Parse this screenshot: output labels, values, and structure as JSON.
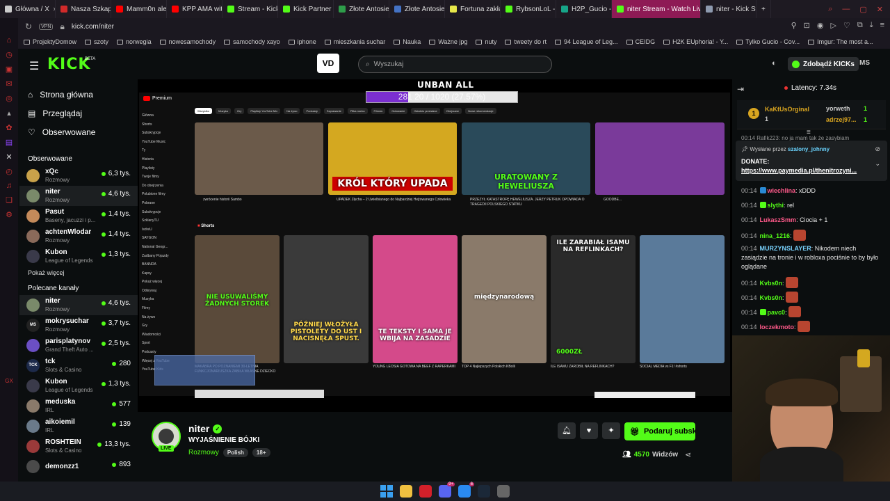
{
  "browser": {
    "tabs": [
      {
        "label": "Główna / X",
        "color": "#cccccc"
      },
      {
        "label": "Nasza Szkapa",
        "color": "#d12a2a"
      },
      {
        "label": "Mamm0n ale",
        "color": "#ff0000"
      },
      {
        "label": "KPP AMA with",
        "color": "#ff0000"
      },
      {
        "label": "Stream - Kick",
        "color": "#53fc18"
      },
      {
        "label": "Kick Partner P",
        "color": "#53fc18"
      },
      {
        "label": "Złote Antosie",
        "color": "#2e9d4a"
      },
      {
        "label": "Złote Antosie",
        "color": "#4472c4"
      },
      {
        "label": "Fortuna zakła",
        "color": "#e8e84a"
      },
      {
        "label": "RybsonLoL -",
        "color": "#53fc18"
      },
      {
        "label": "H2P_Gucio -",
        "color": "#17a589"
      },
      {
        "label": "niter Stream - Watch Live",
        "color": "#53fc18",
        "active": true
      },
      {
        "label": "niter - Kick St",
        "color": "#8e9aaf"
      }
    ],
    "vpn": "VPN",
    "url": "kick.com/niter",
    "bookmarks": [
      "ProjektyDomow",
      "szoty",
      "norwegia",
      "nowesamochody",
      "samochody xayo",
      "iphone",
      "mieszkania suchar",
      "Nauka",
      "Ważne jpg",
      "nuty",
      "tweety do rt",
      "94 League of Leg...",
      "CEIDG",
      "H2K EUphoria! - Y...",
      "Tylko Gucio - Cov...",
      "Imgur: The most a..."
    ]
  },
  "header": {
    "logo": "KICK",
    "beta": "BETA",
    "vd_logo": "VD",
    "search_placeholder": "Wyszukaj",
    "get_kicks": "Zdobądź KICKs",
    "user_initials": "MS"
  },
  "sidebar": {
    "nav": [
      {
        "label": "Strona główna",
        "icon": "home"
      },
      {
        "label": "Przeglądaj",
        "icon": "browse"
      },
      {
        "label": "Obserwowane",
        "icon": "heart"
      }
    ],
    "followed_title": "Obserwowane",
    "followed": [
      {
        "name": "xQc",
        "cat": "Rozmowy",
        "viewers": "6,3 tys.",
        "color": "#c9a24a"
      },
      {
        "name": "niter",
        "cat": "Rozmowy",
        "viewers": "4,6 tys.",
        "color": "#7a8a6a",
        "selected": true
      },
      {
        "name": "Pasut",
        "cat": "Baseny, jacuzzi i p...",
        "viewers": "1,4 tys.",
        "color": "#c48a5a"
      },
      {
        "name": "achtenWlodar",
        "cat": "Rozmowy",
        "viewers": "1,4 tys.",
        "color": "#8a6a5a"
      },
      {
        "name": "Kubon",
        "cat": "League of Legends",
        "viewers": "1,3 tys.",
        "color": "#3a3a4a"
      }
    ],
    "show_more": "Pokaż więcej",
    "recommended_title": "Polecane kanały",
    "recommended": [
      {
        "name": "niter",
        "cat": "Rozmowy",
        "viewers": "4,6 tys.",
        "color": "#7a8a6a",
        "selected": true
      },
      {
        "name": "mokrysuchar",
        "cat": "Rozmowy",
        "viewers": "3,7 tys.",
        "color": "#222222",
        "initials": "MS"
      },
      {
        "name": "parisplatynov",
        "cat": "Grand Theft Auto ...",
        "viewers": "2,5 tys.",
        "color": "#6b4fc4"
      },
      {
        "name": "tck",
        "cat": "Slots & Casino",
        "viewers": "280",
        "color": "#1d2a4a",
        "initials": "TCK"
      },
      {
        "name": "Kubon",
        "cat": "League of Legends",
        "viewers": "1,3 tys.",
        "color": "#3a3a4a"
      },
      {
        "name": "meduska",
        "cat": "IRL",
        "viewers": "577",
        "color": "#8a7a6a"
      },
      {
        "name": "aikoiemil",
        "cat": "IRL",
        "viewers": "139",
        "color": "#6a7a8a"
      },
      {
        "name": "ROSHTEIN",
        "cat": "Slots & Casino",
        "viewers": "13,3 tys.",
        "color": "#9a3a3a"
      },
      {
        "name": "demonzz1",
        "cat": "",
        "viewers": "893",
        "color": "#4a4a4a"
      }
    ]
  },
  "video": {
    "overlay_title": "UNBAN ALL",
    "progress_text": "281 20 / 1020 (27.57%)",
    "progress_fraction": 0.2757,
    "youtube": {
      "premium": "Premium",
      "side_items": [
        "Główna",
        "Shorts",
        "Subskrypcje",
        "YouTube Music",
        "Ty",
        "Historia",
        "Playlisty",
        "Twoje filmy",
        "Do obejrzenia",
        "Polubione filmy",
        "Pobrane",
        "Subskrypcje",
        "SzklanyTU",
        "IsdreU",
        "SAYGON",
        "National Geogr...",
        "Zadbany Pojazdy",
        "BANNDA",
        "Kapsy",
        "Pokaż więcej",
        "Odkrywaj",
        "Muzyka",
        "Filmy",
        "Na żywo",
        "Gry",
        "Wiadomości",
        "Sport",
        "Podcasty",
        "Więcej z YouTube",
        "YouTube Kids"
      ],
      "chips": [
        "Wszystko",
        "Muzyka",
        "Gry",
        "Playlisty YouTube Mix",
        "Na żywo",
        "Podcasty",
        "Szprawanie",
        "Piłka nożna",
        "Filmów",
        "Gotowanie",
        "Ostatnio przesłane",
        "Obejrzane",
        "Nowe rekomendacje"
      ],
      "videos": [
        {
          "overlay": "",
          "caption": "zwrócenie historii Sambo",
          "color": "#6b5a4a"
        },
        {
          "overlay": "KRÓL KTÓRY UPADA",
          "caption": "UPADEK Złycha – 2 Uwielbianego do Najbardziej Hejtowanego Człowieka",
          "color": "#d4a820"
        },
        {
          "overlay": "URATOWANY Z HEWELIUSZA",
          "caption": "PRZEŻYŁ KATASTROFĘ HEWELIUSZA. JERZY PETRUK OPOWIADA O TRAGEDII POLSKIEGO STATKU",
          "color": "#2a4a5a"
        },
        {
          "overlay": "",
          "caption": "GOODBE...",
          "color": "#7a3a9a"
        }
      ],
      "shorts_label": "Shorts",
      "shorts": [
        {
          "overlay": "NIE USUWALIŚMY ŻADNYCH STOREK",
          "caption": "MAKABRA PO POZNANIEMI 30-LETNIA FUNKCJONARIUSZKA ZABIŁA WŁASNE DZIECKO I...",
          "color": "#5a4a3a"
        },
        {
          "overlay": "PÓŹNIEJ WŁOŻYŁA PISTOLETY DO UST I NACISNĘŁA SPUST.",
          "caption": "",
          "color": "#3a3a3a"
        },
        {
          "overlay": "TE TEKSTY I SAMA JE WBIJA NA ZASADZIE",
          "caption": "YOUNG LEOSIA GOTOWA NA BEEF Z RAPERKAMI",
          "color": "#d44a8a"
        },
        {
          "overlay": "międzynarodową",
          "caption": "TOP 4 Najlepszych Polskich KBolli",
          "color": "#8a7a6a"
        },
        {
          "overlay": "ILE ZARABIAŁ ISAMU NA REFLINKACH?",
          "caption": "ILE ISAMU ZAROBIŁ NA REFLINKACH?",
          "color": "#2a2a2a"
        },
        {
          "overlay": "",
          "caption": "SOCIAL MEDIA vs F1! #shorts",
          "color": "#5a7a9a"
        }
      ],
      "price_overlay": "6000ZŁ"
    }
  },
  "stream": {
    "name": "niter",
    "title": "WYJAŚNIENIE BÓJKI",
    "category": "Rozmowy",
    "tags": [
      "Polish",
      "18+"
    ],
    "live": "LIVE",
    "subscribe": "Podaruj subskry",
    "viewers": "4570",
    "viewers_label": "Widzów"
  },
  "chat": {
    "latency": "Latency: 7.34s",
    "leaderboard": [
      {
        "name": "KaKtUsOrginal",
        "count": "1",
        "rank": "1"
      },
      {
        "name": "yorweth",
        "count": "1"
      },
      {
        "name": "adrzej97...",
        "count": "1"
      }
    ],
    "cut_message": "00:14 Rafik223: no ja mam tak że zasybiam",
    "pinned": {
      "by_label": "Wysłane przez",
      "by_user": "szalony_johnny",
      "title": "DONATE:",
      "link": "https://www.paymedia.pl/thenitrozyni..."
    },
    "messages": [
      {
        "time": "00:14",
        "user": "wiechlina",
        "color": "#ff5a8a",
        "text": ": xDDD",
        "badge": "#2a8ad4"
      },
      {
        "time": "00:14",
        "user": "slythi",
        "color": "#53fc18",
        "text": ": rel",
        "badge": "#53fc18"
      },
      {
        "time": "00:14",
        "user": "LukaszSmm",
        "color": "#ff5a8a",
        "text": ": Ciocia + 1"
      },
      {
        "time": "00:14",
        "user": "nina_1216",
        "color": "#53fc18",
        "text": ":",
        "emote": true
      },
      {
        "time": "00:14",
        "user": "MURZYNSLAYER",
        "color": "#7ad4ff",
        "text": ": Nikodem niech zasiądzie na tronie i w robloxa pociśnie to by było oglądane"
      },
      {
        "time": "00:14",
        "user": "Kvbs0n",
        "color": "#53fc18",
        "text": ":",
        "emote": true
      },
      {
        "time": "00:14",
        "user": "Kvbs0n",
        "color": "#53fc18",
        "text": ":",
        "emote": true
      },
      {
        "time": "00:14",
        "user": "pavc0",
        "color": "#53fc18",
        "text": ":",
        "emote": true,
        "badge": "#53fc18"
      },
      {
        "time": "00:14",
        "user": "loczekmoto",
        "color": "#ff5a8a",
        "text": ":",
        "emote": true
      }
    ]
  },
  "taskbar": {
    "icons": [
      "windows",
      "explorer",
      "opera",
      "discord",
      "messenger",
      "steam",
      "settings"
    ],
    "discord_badge": "9+",
    "messenger_badge": "6"
  }
}
